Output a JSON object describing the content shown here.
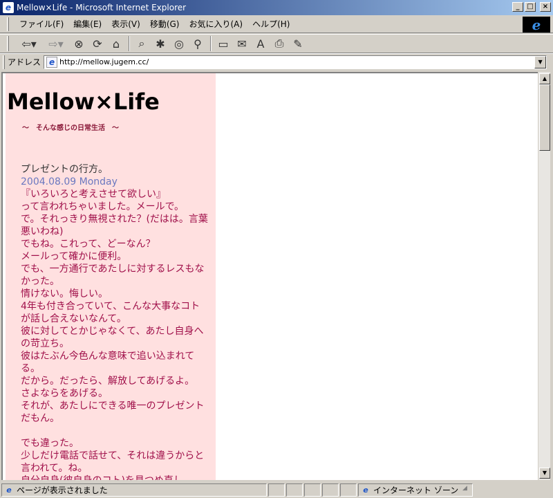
{
  "window": {
    "title": "Mellow×Life - Microsoft Internet Explorer",
    "buttons": {
      "minimize": "_",
      "maximize": "□",
      "close": "×"
    }
  },
  "menu": {
    "items": [
      "ファイル(F)",
      "編集(E)",
      "表示(V)",
      "移動(G)",
      "お気に入り(A)",
      "ヘルプ(H)"
    ]
  },
  "toolbar": {
    "icons": [
      "back-icon",
      "forward-icon",
      "stop-icon",
      "refresh-icon",
      "home-icon",
      "search-icon",
      "favorites-icon",
      "history-icon",
      "channels-icon",
      "fullscreen-icon",
      "mail-icon",
      "font-icon",
      "print-icon",
      "edit-icon"
    ],
    "glyphs": {
      "back": "⇦▾",
      "forward": "⇨▾",
      "stop": "⊗",
      "refresh": "⟳",
      "home": "⌂",
      "search": "⌕",
      "favorites": "✱",
      "history": "◎",
      "channels": "⚲",
      "fullscreen": "▭",
      "mail": "✉",
      "font": "A",
      "print": "⎙",
      "edit": "✎"
    }
  },
  "address": {
    "label": "アドレス",
    "url": "http://mellow.jugem.cc/",
    "page_icon": "e",
    "drop": "▼"
  },
  "page": {
    "blog_title": "Mellow×Life",
    "tagline": "～　そんな感じの日常生活　～",
    "post": {
      "title": "プレゼントの行方。",
      "date": "2004.08.09 Monday",
      "lines": [
        "『いろいろと考えさせて欲しい』",
        "って言われちゃいました。メールで。",
        "で。それっきり無視された？(だはは。言葉悪いわね)",
        "でもね。これって、どーなん？",
        "メールって確かに便利。",
        "でも、一方通行であたしに対するレスもなかった。",
        "情けない。悔しい。",
        "4年も付き合っていて、こんな大事なコトが話し合えないなんて。",
        "彼に対してとかじゃなくて、あたし自身への苛立ち。",
        "彼はたぶん今色んな意味で追い込まれてる。",
        "だから。だったら、解放してあげるよ。",
        "さよならをあげる。",
        "それが、あたしにできる唯一のプレゼントだもん。",
        "",
        "でも違った。",
        "少しだけ電話で話せて、それは違うからと言われて。ね。",
        "自分自身(彼自身のコト)を見つめ直し"
      ]
    }
  },
  "scroll": {
    "up": "▲",
    "down": "▼"
  },
  "status": {
    "text": "ページが表示されました",
    "zone": "インターネット ゾーン",
    "zone_icon": "e",
    "resize": "◢"
  },
  "colors": {
    "sidebar_bg": "#ffe0e0",
    "post_text": "#a0104a",
    "date_text": "#6a78c0",
    "titlebar": "#0a246a"
  }
}
